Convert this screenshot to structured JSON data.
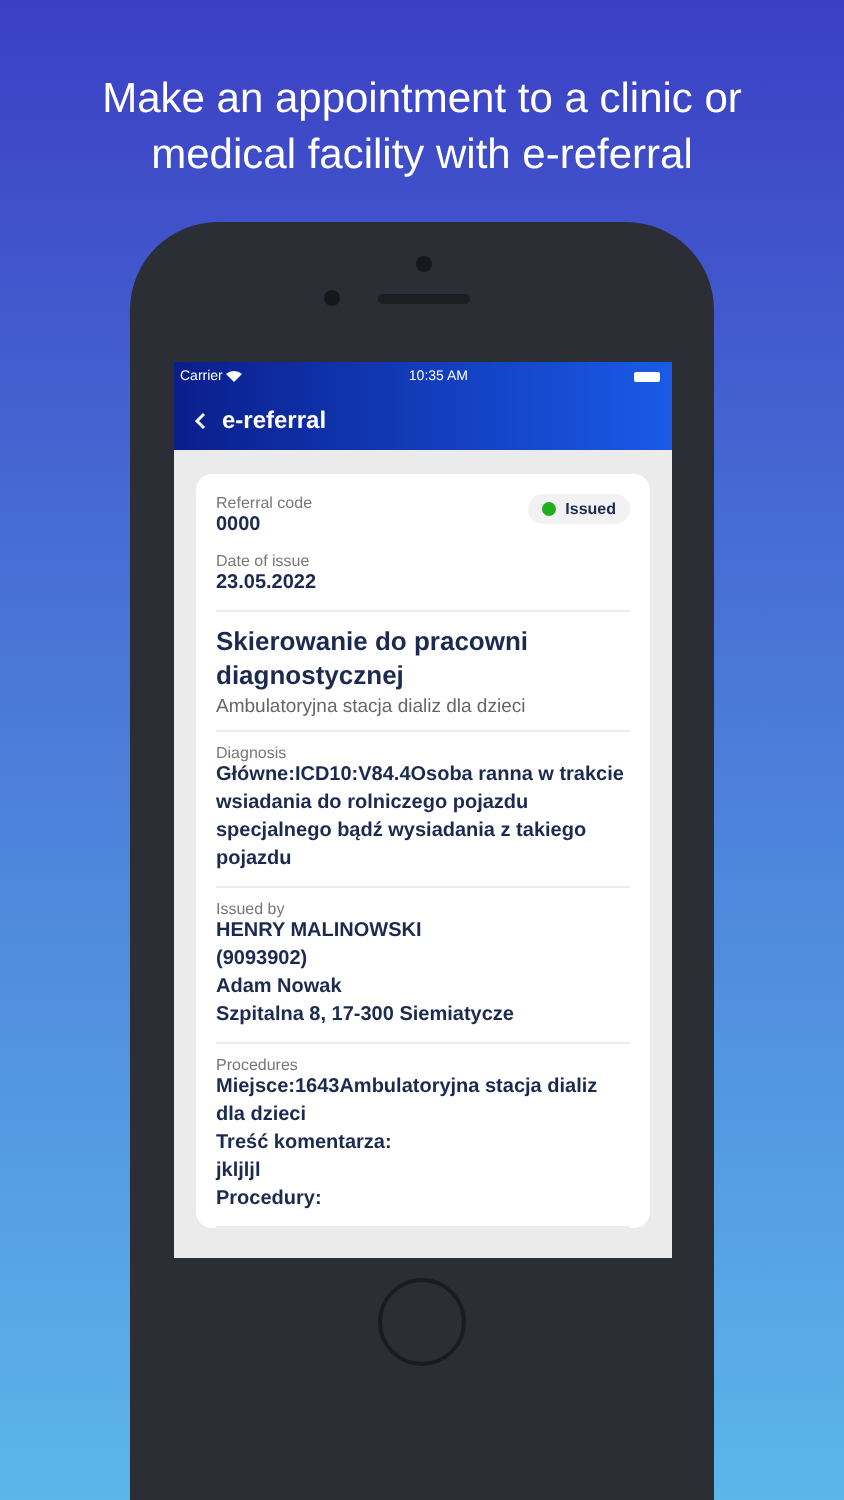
{
  "headline": "Make an appointment to a clinic or medical facility with e-referral",
  "status_bar": {
    "carrier": "Carrier",
    "time": "10:35 AM"
  },
  "nav": {
    "title": "e-referral"
  },
  "referral": {
    "code_label": "Referral code",
    "code": "0000",
    "status": "Issued",
    "date_label": "Date of issue",
    "date": "23.05.2022"
  },
  "title": "Skierowanie do pracowni diagnostycznej",
  "subtitle": "Ambulatoryjna stacja dializ dla dzieci",
  "sections": [
    {
      "label": "Diagnosis",
      "lines": [
        "Główne:ICD10:V84.4Osoba ranna w trakcie wsiadania do rolniczego pojazdu specjalnego bądź wysiadania z takiego pojazdu"
      ]
    },
    {
      "label": "Issued by",
      "lines": [
        "HENRY MALINOWSKI",
        "(9093902)",
        "Adam Nowak",
        "Szpitalna 8, 17-300 Siemiatycze"
      ]
    },
    {
      "label": "Procedures",
      "lines": [
        "Miejsce:1643Ambulatoryjna stacja dializ dla dzieci",
        "Treść komentarza:",
        "jkljljl",
        "Procedury:"
      ]
    }
  ]
}
